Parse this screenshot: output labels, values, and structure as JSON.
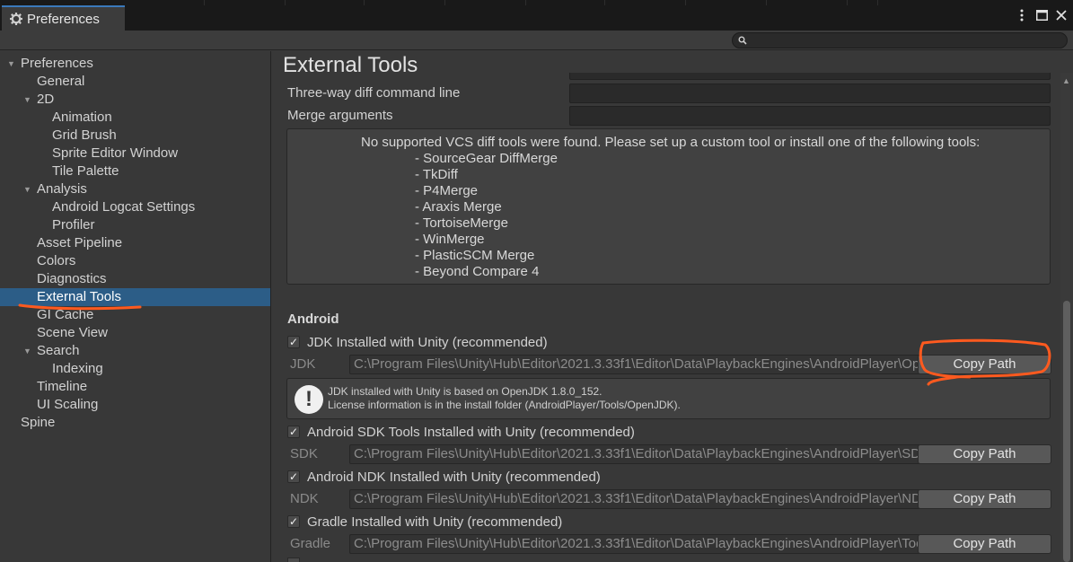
{
  "window": {
    "tab_title": "Preferences"
  },
  "search": {
    "placeholder": "",
    "value": ""
  },
  "sidebar": {
    "items": [
      {
        "label": "Preferences",
        "level": 0,
        "expanded": true
      },
      {
        "label": "General",
        "level": 1
      },
      {
        "label": "2D",
        "level": 1,
        "expanded": true
      },
      {
        "label": "Animation",
        "level": 2
      },
      {
        "label": "Grid Brush",
        "level": 2
      },
      {
        "label": "Sprite Editor Window",
        "level": 2
      },
      {
        "label": "Tile Palette",
        "level": 2
      },
      {
        "label": "Analysis",
        "level": 1,
        "expanded": true
      },
      {
        "label": "Android Logcat Settings",
        "level": 2
      },
      {
        "label": "Profiler",
        "level": 2
      },
      {
        "label": "Asset Pipeline",
        "level": 1
      },
      {
        "label": "Colors",
        "level": 1
      },
      {
        "label": "Diagnostics",
        "level": 1
      },
      {
        "label": "External Tools",
        "level": 1,
        "selected": true
      },
      {
        "label": "GI Cache",
        "level": 1
      },
      {
        "label": "Scene View",
        "level": 1
      },
      {
        "label": "Search",
        "level": 1,
        "expanded": true
      },
      {
        "label": "Indexing",
        "level": 2
      },
      {
        "label": "Timeline",
        "level": 1
      },
      {
        "label": "UI Scaling",
        "level": 1
      },
      {
        "label": "Spine",
        "level": 0
      }
    ]
  },
  "main": {
    "title": "External Tools",
    "three_way_label": "Three-way diff command line",
    "three_way_value": "",
    "merge_args_label": "Merge arguments",
    "merge_args_value": "",
    "vcs_help": {
      "intro": "No supported VCS diff tools were found. Please set up a custom tool or install one of the following tools:",
      "tools": [
        "- SourceGear DiffMerge",
        "- TkDiff",
        "- P4Merge",
        "- Araxis Merge",
        "- TortoiseMerge",
        "- WinMerge",
        "- PlasticSCM Merge",
        "- Beyond Compare 4"
      ]
    },
    "android": {
      "section_label": "Android",
      "jdk_check_label": "JDK Installed with Unity (recommended)",
      "jdk_label": "JDK",
      "jdk_path": "C:\\Program Files\\Unity\\Hub\\Editor\\2021.3.33f1\\Editor\\Data\\PlaybackEngines\\AndroidPlayer\\OpenJDK",
      "jdk_info_line1": "JDK installed with Unity is based on OpenJDK 1.8.0_152.",
      "jdk_info_line2": "License information is in the install folder (AndroidPlayer/Tools/OpenJDK).",
      "sdk_check_label": "Android SDK Tools Installed with Unity (recommended)",
      "sdk_label": "SDK",
      "sdk_path": "C:\\Program Files\\Unity\\Hub\\Editor\\2021.3.33f1\\Editor\\Data\\PlaybackEngines\\AndroidPlayer\\SDK",
      "ndk_check_label": "Android NDK Installed with Unity (recommended)",
      "ndk_label": "NDK",
      "ndk_path": "C:\\Program Files\\Unity\\Hub\\Editor\\2021.3.33f1\\Editor\\Data\\PlaybackEngines\\AndroidPlayer\\NDK",
      "gradle_check_label": "Gradle Installed with Unity (recommended)",
      "gradle_label": "Gradle",
      "gradle_path": "C:\\Program Files\\Unity\\Hub\\Editor\\2021.3.33f1\\Editor\\Data\\PlaybackEngines\\AndroidPlayer\\Tools\\gradle",
      "copy_path_label": "Copy Path",
      "check_glyph": "✓"
    }
  },
  "colors": {
    "selection": "#2c5d87",
    "annotation": "#ff5a1f"
  },
  "icons": {
    "window": "gear-icon",
    "search": "search-icon",
    "warning": "exclamation-icon"
  }
}
